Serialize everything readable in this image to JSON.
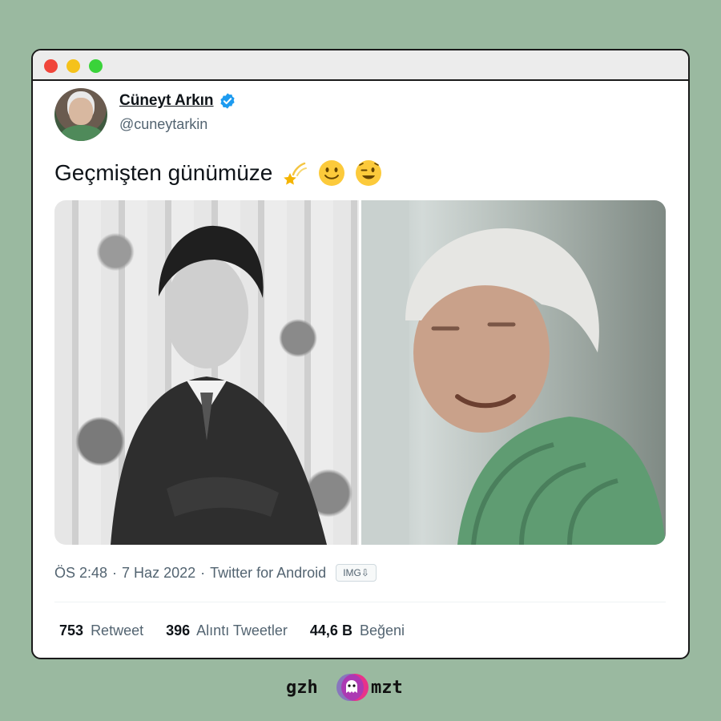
{
  "tweet": {
    "display_name": "Cüneyt Arkın",
    "handle": "@cuneytarkin",
    "text": "Geçmişten günümüze",
    "emojis": [
      "dizzy-star",
      "slightly-smiling-face",
      "winking-face"
    ],
    "time": "ÖS 2:48",
    "date": "7 Haz 2022",
    "source": "Twitter for Android",
    "img_badge": "IMG⇩",
    "stats": {
      "retweets_count": "753",
      "retweets_label": "Retweet",
      "quotes_count": "396",
      "quotes_label": "Alıntı Tweetler",
      "likes_count": "44,6 B",
      "likes_label": "Beğeni"
    }
  },
  "brand": {
    "logo_text": "gzhamzt",
    "background_color": "#9ab9a0"
  },
  "colors": {
    "verified": "#1d9bf0",
    "text_primary": "#0f1419",
    "text_secondary": "#536471"
  }
}
